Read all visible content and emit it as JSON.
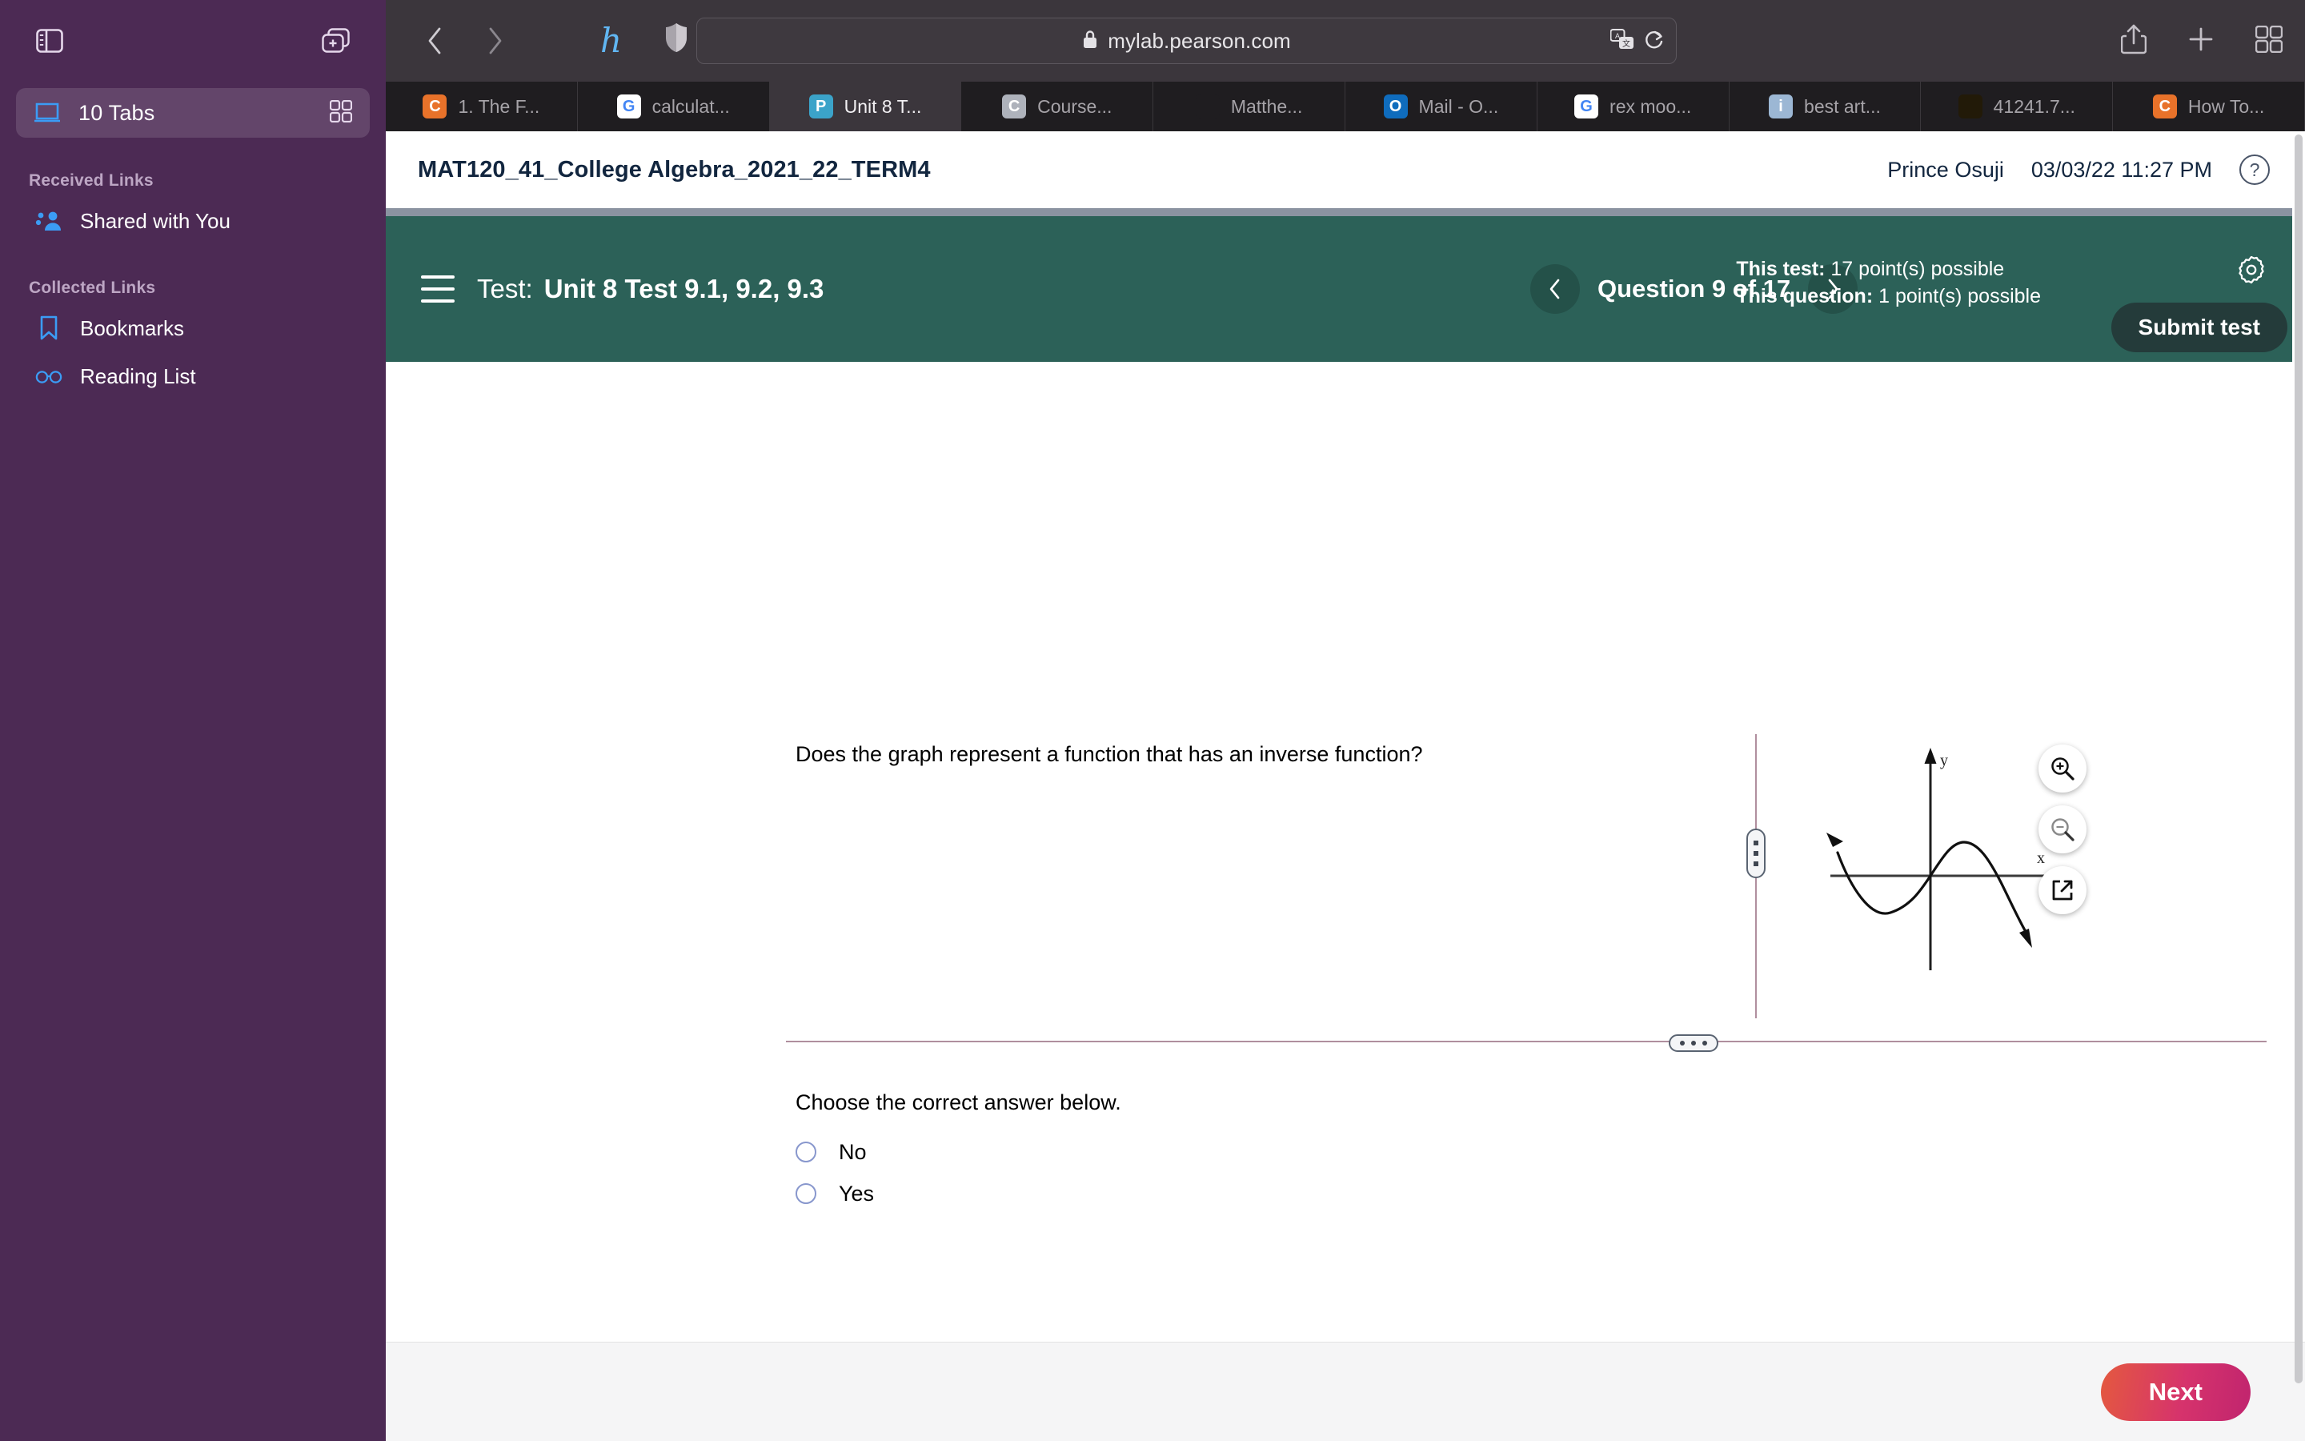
{
  "sidebar": {
    "toolbar": {
      "sidebar_toggle_icon": "sidebar-icon",
      "new_tab_group_icon": "new-tab-group-icon"
    },
    "tabs_row": {
      "label": "10 Tabs",
      "grid_icon": "grid-icon",
      "window-icon": "window-icon"
    },
    "sections": [
      {
        "title": "Received Links",
        "items": [
          {
            "label": "Shared with You",
            "icon": "shared-with-you-icon"
          }
        ]
      },
      {
        "title": "Collected Links",
        "items": [
          {
            "label": "Bookmarks",
            "icon": "bookmark-icon"
          },
          {
            "label": "Reading List",
            "icon": "glasses-icon"
          }
        ]
      }
    ]
  },
  "browser": {
    "back_icon": "back-arrow-icon",
    "forward_icon": "forward-arrow-icon",
    "honey_label": "h",
    "shield_icon": "shield-icon",
    "address": {
      "lock_icon": "lock-icon",
      "url": "mylab.pearson.com",
      "translate_icon": "translate-icon",
      "reload_icon": "reload-icon"
    },
    "share_icon": "share-icon",
    "new_tab_icon": "plus-icon",
    "tab_overview_icon": "tab-overview-icon",
    "tabs": [
      {
        "label": "1. The F...",
        "favicon": "canvas-icon",
        "fav_text": "C",
        "fav_bg": "#e8722a",
        "fav_color": "#ffffff",
        "active": false
      },
      {
        "label": "calculat...",
        "favicon": "google-icon",
        "fav_text": "G",
        "fav_bg": "#ffffff",
        "fav_color": "#4285f4",
        "active": false
      },
      {
        "label": "Unit 8 T...",
        "favicon": "pearson-icon",
        "fav_text": "P",
        "fav_bg": "#3ba3c9",
        "fav_color": "#ffffff",
        "active": true
      },
      {
        "label": "Course...",
        "favicon": "canvas-gray-icon",
        "fav_text": "C",
        "fav_bg": "#aeb2bb",
        "fav_color": "#ffffff",
        "active": false
      },
      {
        "label": "Matthe...",
        "favicon": "bars-icon",
        "fav_text": "",
        "fav_bg": "#1f1d20",
        "fav_color": "#e2453c",
        "active": false
      },
      {
        "label": "Mail - O...",
        "favicon": "outlook-icon",
        "fav_text": "O",
        "fav_bg": "#0f6cbd",
        "fav_color": "#ffffff",
        "active": false
      },
      {
        "label": "rex moo...",
        "favicon": "google-icon",
        "fav_text": "G",
        "fav_bg": "#ffffff",
        "fav_color": "#4285f4",
        "active": false
      },
      {
        "label": "best art...",
        "favicon": "info-icon",
        "fav_text": "i",
        "fav_bg": "#9cb7d4",
        "fav_color": "#ffffff",
        "active": false
      },
      {
        "label": "41241.7...",
        "favicon": "flame-icon",
        "fav_text": "",
        "fav_bg": "#221a08",
        "fav_color": "#f5a623",
        "active": false
      },
      {
        "label": "How To...",
        "favicon": "canvas-icon",
        "fav_text": "C",
        "fav_bg": "#e8722a",
        "fav_color": "#ffffff",
        "active": false
      }
    ]
  },
  "page": {
    "course_title": "MAT120_41_College Algebra_2021_22_TERM4",
    "user_name": "Prince Osuji",
    "timestamp": "03/03/22 11:27 PM",
    "help_icon": "help-icon",
    "test_bar": {
      "menu_icon": "hamburger-menu-icon",
      "test_label": "Test:",
      "test_name": "Unit 8 Test 9.1, 9.2, 9.3",
      "prev_icon": "chevron-left-icon",
      "next_icon": "chevron-right-icon",
      "question_counter": "Question 9 of 17",
      "points_test_label": "This test:",
      "points_test_value": "17 point(s) possible",
      "points_question_label": "This question:",
      "points_question_value": "1 point(s) possible",
      "settings_icon": "gear-icon",
      "submit_label": "Submit test"
    },
    "question": {
      "prompt": "Does the graph represent a function that has an inverse function?",
      "choose_label": "Choose the correct answer below.",
      "choices": [
        {
          "label": "No",
          "selected": false
        },
        {
          "label": "Yes",
          "selected": false
        }
      ],
      "graph": {
        "x_axis_label": "x",
        "y_axis_label": "y",
        "zoom_in_icon": "zoom-in-icon",
        "zoom_out_icon": "zoom-out-icon",
        "popout_icon": "popout-icon"
      }
    },
    "next_label": "Next"
  },
  "chart_data": {
    "type": "line",
    "title": "",
    "xlabel": "x",
    "ylabel": "y",
    "grid": false,
    "legend": null,
    "description": "Cubic-shaped curve with negative leading coefficient: rises to an arrow at upper-left, falls through a local minimum left of the origin, crosses the origin, rises to a local maximum right of the origin, then falls to an arrow at lower-right. Fails the horizontal line test.",
    "axis_arrows": {
      "x_positive": true,
      "y_positive": true
    },
    "x": [
      -4.2,
      -3.6,
      -3.0,
      -2.4,
      -1.8,
      -1.2,
      -0.6,
      0.0,
      0.6,
      1.2,
      1.8,
      2.4,
      3.0,
      3.4
    ],
    "values": [
      2.4,
      1.0,
      0.0,
      -0.9,
      -1.35,
      -1.2,
      -0.7,
      0.0,
      0.75,
      1.2,
      1.1,
      0.2,
      -1.6,
      -2.9
    ]
  }
}
